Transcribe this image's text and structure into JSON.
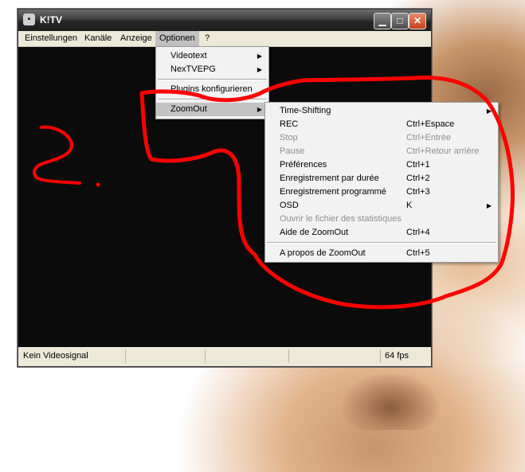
{
  "window": {
    "title": "K!TV",
    "icon": "ktv-app-icon",
    "controls": {
      "minimize": "minimize-icon",
      "maximize": "maximize-icon",
      "close": "close-icon"
    }
  },
  "menubar": {
    "items": [
      "Einstellungen",
      "Kanäle",
      "Anzeige",
      "Optionen",
      "?"
    ],
    "active": "Optionen"
  },
  "options_menu": {
    "items": [
      {
        "label": "Videotext",
        "submenu": true
      },
      {
        "label": "NexTVEPG",
        "submenu": true
      },
      {
        "label": "Plugins konfigurieren",
        "submenu": false
      },
      {
        "label": "ZoomOut",
        "submenu": true,
        "highlighted": true
      }
    ]
  },
  "zoomout_menu": {
    "items": [
      {
        "label": "Time-Shifting",
        "shortcut": "",
        "submenu": true,
        "disabled": false
      },
      {
        "label": "REC",
        "shortcut": "Ctrl+Espace",
        "submenu": false,
        "disabled": false
      },
      {
        "label": "Stop",
        "shortcut": "Ctrl+Entrée",
        "submenu": false,
        "disabled": true
      },
      {
        "label": "Pause",
        "shortcut": "Ctrl+Retour arrière",
        "submenu": false,
        "disabled": true
      },
      {
        "label": "Préférences",
        "shortcut": "Ctrl+1",
        "submenu": false,
        "disabled": false
      },
      {
        "label": "Enregistrement par durée",
        "shortcut": "Ctrl+2",
        "submenu": false,
        "disabled": false
      },
      {
        "label": "Enregistrement programmé",
        "shortcut": "Ctrl+3",
        "submenu": false,
        "disabled": false
      },
      {
        "label": "OSD",
        "shortcut": "K",
        "submenu": true,
        "disabled": false
      },
      {
        "label": "Ouvrir le fichier des statistiques",
        "shortcut": "",
        "submenu": false,
        "disabled": true
      },
      {
        "label": "Aide de ZoomOut",
        "shortcut": "Ctrl+4",
        "submenu": false,
        "disabled": false
      },
      {
        "label": "A propos de ZoomOut",
        "shortcut": "Ctrl+5",
        "submenu": false,
        "disabled": false
      }
    ]
  },
  "statusbar": {
    "signal": "Kein Videosignal",
    "fps": "64 fps"
  },
  "annotation": {
    "text": "2.",
    "color": "#ff0000"
  },
  "colors": {
    "window_bg": "#0a0a0a",
    "menu_bg": "#f2f2f2",
    "highlight": "#c3c3c3",
    "disabled_text": "#8f8f8f"
  }
}
